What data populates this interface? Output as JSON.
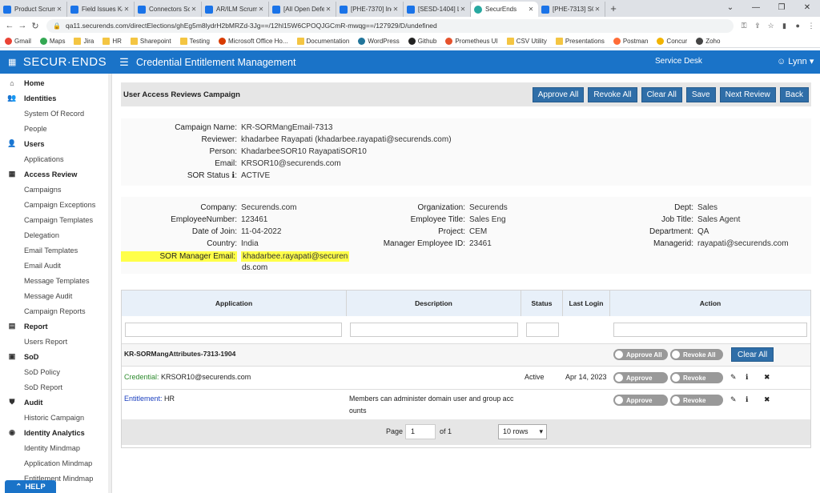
{
  "browser": {
    "tabs": [
      {
        "label": "Product Scrum B",
        "color": "#1a73e8"
      },
      {
        "label": "Field Issues Kanb",
        "color": "#1a73e8"
      },
      {
        "label": "Connectors Scrum",
        "color": "#1a73e8"
      },
      {
        "label": "AR/ILM Scrum Bo",
        "color": "#1a73e8"
      },
      {
        "label": "[All Open Defects",
        "color": "#1a73e8"
      },
      {
        "label": "[PHE-7370] Inde",
        "color": "#1a73e8"
      },
      {
        "label": "[SESD-1404] Lun",
        "color": "#1a73e8"
      },
      {
        "label": "SecurEnds",
        "color": "#27a8a0",
        "active": true
      },
      {
        "label": "[PHE-7313] SOR",
        "color": "#1a73e8"
      }
    ],
    "url": "qa11.securends.com/directElections/ghEg5m8lydrH2bMRZd-3Jg==/12hl15W6CPOQJGCmR-mwqg==/127929/D/undefined",
    "bookmarks": [
      {
        "label": "Gmail",
        "icon": "gmail-icon"
      },
      {
        "label": "Maps",
        "icon": "maps-icon"
      },
      {
        "label": "Jira",
        "icon": "folder-icon"
      },
      {
        "label": "HR",
        "icon": "folder-icon"
      },
      {
        "label": "Sharepoint",
        "icon": "folder-icon"
      },
      {
        "label": "Testing",
        "icon": "folder-icon"
      },
      {
        "label": "Microsoft Office Ho...",
        "icon": "office-icon"
      },
      {
        "label": "Documentation",
        "icon": "folder-icon"
      },
      {
        "label": "WordPress",
        "icon": "wordpress-icon"
      },
      {
        "label": "Github",
        "icon": "github-icon"
      },
      {
        "label": "Prometheus UI",
        "icon": "prometheus-icon"
      },
      {
        "label": "CSV Utility",
        "icon": "folder-icon"
      },
      {
        "label": "Presentations",
        "icon": "folder-icon"
      },
      {
        "label": "Postman",
        "icon": "postman-icon"
      },
      {
        "label": "Concur",
        "icon": "concur-icon"
      },
      {
        "label": "Zoho",
        "icon": "zoho-icon"
      }
    ]
  },
  "header": {
    "logo": "SECUR·ENDS",
    "title": "Credential Entitlement Management",
    "service_desk": "Service Desk",
    "user": "Lynn",
    "color": "#1a73c8"
  },
  "sidebar": {
    "items": [
      {
        "label": "Home",
        "type": "section",
        "icon": "home-icon",
        "glyph": "⌂"
      },
      {
        "label": "Identities",
        "type": "section",
        "icon": "users-icon",
        "glyph": "👥"
      },
      {
        "label": "System Of Record",
        "type": "sub"
      },
      {
        "label": "People",
        "type": "sub"
      },
      {
        "label": "Users",
        "type": "section",
        "icon": "user-icon",
        "glyph": "👤"
      },
      {
        "label": "Applications",
        "type": "sub"
      },
      {
        "label": "Access Review",
        "type": "section",
        "icon": "grid-icon",
        "glyph": "▦"
      },
      {
        "label": "Campaigns",
        "type": "sub"
      },
      {
        "label": "Campaign Exceptions",
        "type": "sub"
      },
      {
        "label": "Campaign Templates",
        "type": "sub"
      },
      {
        "label": "Delegation",
        "type": "sub"
      },
      {
        "label": "Email Templates",
        "type": "sub"
      },
      {
        "label": "Email Audit",
        "type": "sub"
      },
      {
        "label": "Message Templates",
        "type": "sub"
      },
      {
        "label": "Message Audit",
        "type": "sub"
      },
      {
        "label": "Campaign Reports",
        "type": "sub"
      },
      {
        "label": "Report",
        "type": "section",
        "icon": "report-icon",
        "glyph": "▤"
      },
      {
        "label": "Users Report",
        "type": "sub"
      },
      {
        "label": "SoD",
        "type": "section",
        "icon": "sod-icon",
        "glyph": "▣"
      },
      {
        "label": "SoD Policy",
        "type": "sub"
      },
      {
        "label": "SoD Report",
        "type": "sub"
      },
      {
        "label": "Audit",
        "type": "section",
        "icon": "shield-icon",
        "glyph": "⛊"
      },
      {
        "label": "Historic Campaign",
        "type": "sub"
      },
      {
        "label": "Identity Analytics",
        "type": "section",
        "icon": "analytics-icon",
        "glyph": "◉"
      },
      {
        "label": "Identity Mindmap",
        "type": "sub"
      },
      {
        "label": "Application Mindmap",
        "type": "sub"
      },
      {
        "label": "Entitlement Mindmap",
        "type": "sub"
      }
    ],
    "help": "HELP"
  },
  "campaign": {
    "title": "User Access Reviews Campaign",
    "buttons": [
      "Approve All",
      "Revoke All",
      "Clear All",
      "Save",
      "Next Review",
      "Back"
    ]
  },
  "summary": {
    "campaign_name_label": "Campaign Name:",
    "campaign_name": "KR-SORMangEmail-7313",
    "reviewer_label": "Reviewer:",
    "reviewer": "khadarbee Rayapati (khadarbee.rayapati@securends.com)",
    "person_label": "Person:",
    "person": "KhadarbeeSOR10 RayapatiSOR10",
    "email_label": "Email:",
    "email": "KRSOR10@securends.com",
    "sor_status_label": "SOR Status",
    "sor_status": "ACTIVE"
  },
  "details": {
    "company_label": "Company:",
    "company": "Securends.com",
    "empnum_label": "EmployeeNumber:",
    "empnum": "123461",
    "doj_label": "Date of Join:",
    "doj": "11-04-2022",
    "country_label": "Country:",
    "country": "India",
    "sor_mgr_label": "SOR Manager Email:",
    "sor_mgr_1": "khadarbee.rayapati@securen",
    "sor_mgr_2": "ds.com",
    "org_label": "Organization:",
    "org": "Securends",
    "title_label": "Employee Title:",
    "title": "Sales Eng",
    "project_label": "Project:",
    "project": "CEM",
    "mgr_id_label": "Manager Employee ID:",
    "mgr_id": "23461",
    "dept_label": "Dept:",
    "dept": "Sales",
    "job_label": "Job Title:",
    "job": "Sales Agent",
    "department_label": "Department:",
    "department": "QA",
    "managerid_label": "Managerid:",
    "managerid": "rayapati@securends.com"
  },
  "table": {
    "headers": [
      "Application",
      "Description",
      "Status",
      "Last Login",
      "Action"
    ],
    "group": {
      "name": "KR-SORMangAttributes-7313-1904",
      "approve_all": "Approve All",
      "revoke_all": "Revoke All",
      "clear_all": "Clear All"
    },
    "rows": [
      {
        "type_label": "Credential:",
        "value": "KRSOR10@securends.com",
        "type_color": "#2e8b2e",
        "desc1": "",
        "desc2": "",
        "status": "Active",
        "last_login": "Apr 14, 2023",
        "approve": "Approve",
        "revoke": "Revoke"
      },
      {
        "type_label": "Entitlement:",
        "value": "HR",
        "type_color": "#1a3fbf",
        "desc1": "Members can administer domain user and group acc",
        "desc2": "ounts",
        "status": "",
        "last_login": "",
        "approve": "Approve",
        "revoke": "Revoke"
      }
    ],
    "pager": {
      "page_label": "Page",
      "page": "1",
      "of_label": "of 1",
      "rows": "10 rows"
    }
  }
}
